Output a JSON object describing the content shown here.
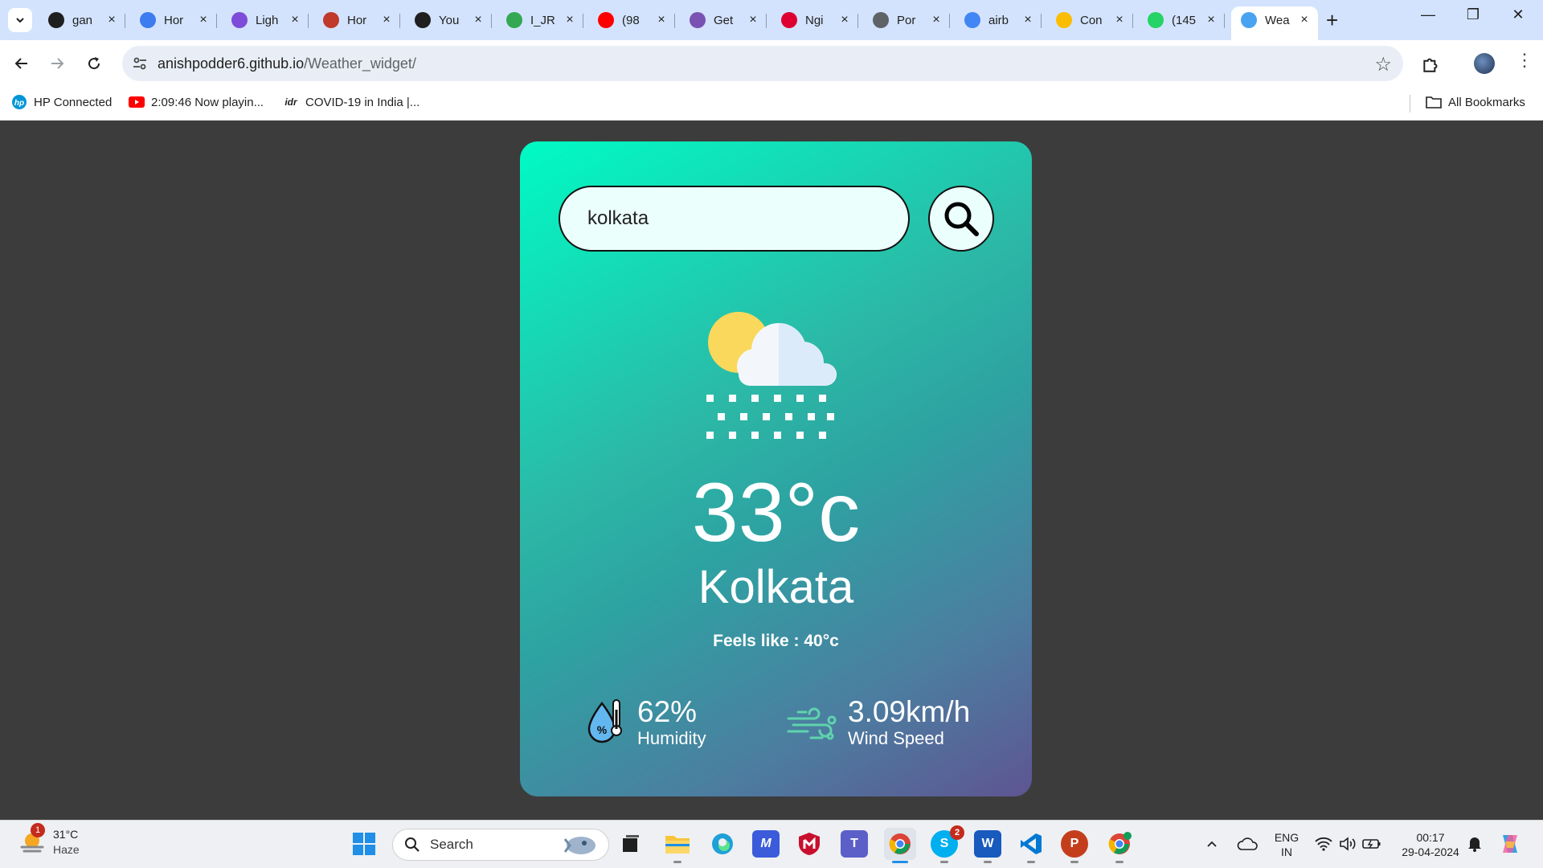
{
  "browser": {
    "tabs": [
      {
        "title": "gan",
        "icon": "github-icon",
        "color": "#1f1f1f"
      },
      {
        "title": "Hor",
        "icon": "c-logo-icon",
        "color": "#3d7bf0"
      },
      {
        "title": "Ligh",
        "icon": "calendar-icon",
        "color": "#7d4cd9"
      },
      {
        "title": "Hor",
        "icon": "emblem-icon",
        "color": "#c0392b"
      },
      {
        "title": "You",
        "icon": "github-icon",
        "color": "#1f1f1f"
      },
      {
        "title": "I_JR",
        "icon": "pinwheel-icon",
        "color": "#34a853"
      },
      {
        "title": "(98",
        "icon": "youtube-icon",
        "color": "#ff0000"
      },
      {
        "title": "Get",
        "icon": "b-logo-icon",
        "color": "#7952b3"
      },
      {
        "title": "Ngi",
        "icon": "angular-icon",
        "color": "#dd0031"
      },
      {
        "title": "Por",
        "icon": "globe-icon",
        "color": "#5f6368"
      },
      {
        "title": "airb",
        "icon": "google-icon",
        "color": "#4285f4"
      },
      {
        "title": "Con",
        "icon": "drive-icon",
        "color": "#fbbc04"
      },
      {
        "title": "(145",
        "icon": "whatsapp-icon",
        "color": "#25d366"
      },
      {
        "title": "Wea",
        "icon": "weather-tab-icon",
        "color": "#4aa3f0"
      }
    ],
    "url_host": "anishpodder6.github.io",
    "url_path": "/Weather_widget/",
    "bookmarks": [
      {
        "label": "HP Connected",
        "icon": "hp-icon"
      },
      {
        "label": "2:09:46 Now playin...",
        "icon": "youtube-icon"
      },
      {
        "label": "COVID-19 in India |...",
        "icon": "idr-icon"
      }
    ],
    "all_bookmarks": "All Bookmarks"
  },
  "widget": {
    "search_value": "kolkata",
    "temperature": "33°c",
    "city": "Kolkata",
    "feels_like": "Feels like : 40°c",
    "humidity_value": "62%",
    "humidity_label": "Humidity",
    "wind_value": "3.09km/h",
    "wind_label": "Wind Speed"
  },
  "taskbar": {
    "weather_temp": "31°C",
    "weather_desc": "Haze",
    "weather_badge": "1",
    "search_label": "Search",
    "skype_badge": "2",
    "lang_top": "ENG",
    "lang_bottom": "IN",
    "time": "00:17",
    "date": "29-04-2024"
  },
  "colors": {
    "card_gradient_start": "#00fbc4",
    "card_gradient_end": "#5e5592",
    "page_bg": "#3c3c3c",
    "tabstrip_bg": "#d3e3fd"
  }
}
